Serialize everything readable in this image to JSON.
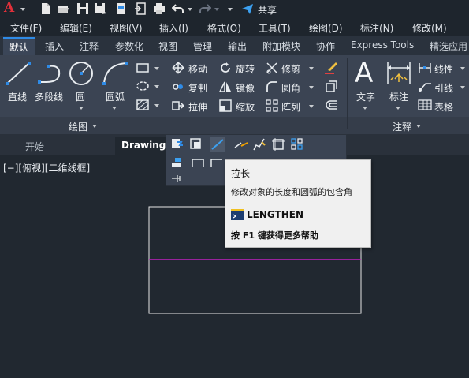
{
  "app": {
    "logo_letter": "A"
  },
  "qat": {
    "share_label": "共享"
  },
  "menubar": [
    "文件(F)",
    "编辑(E)",
    "视图(V)",
    "插入(I)",
    "格式(O)",
    "工具(T)",
    "绘图(D)",
    "标注(N)",
    "修改(M)"
  ],
  "ribbon_tabs": [
    {
      "label": "默认",
      "active": true
    },
    {
      "label": "插入"
    },
    {
      "label": "注释"
    },
    {
      "label": "参数化"
    },
    {
      "label": "视图"
    },
    {
      "label": "管理"
    },
    {
      "label": "输出"
    },
    {
      "label": "附加模块"
    },
    {
      "label": "协作"
    },
    {
      "label": "Express Tools"
    },
    {
      "label": "精选应用"
    }
  ],
  "draw_panel": {
    "title": "绘图",
    "line": "直线",
    "polyline": "多段线",
    "circle": "圆",
    "arc": "圆弧"
  },
  "modify_panel": {
    "move": "移动",
    "rotate": "旋转",
    "trim": "修剪",
    "copy": "复制",
    "mirror": "镜像",
    "fillet": "圆角",
    "stretch": "拉伸",
    "scale": "缩放",
    "array": "阵列"
  },
  "annotation_panel": {
    "title": "注释",
    "text": "文字",
    "dimension": "标注",
    "linear": "线性",
    "leader": "引线",
    "table": "表格"
  },
  "file_tabs": {
    "start": "开始",
    "drawing": "Drawing1"
  },
  "viewport": {
    "label": "[−][俯视][二维线框]"
  },
  "tooltip": {
    "title": "拉长",
    "description": "修改对象的长度和圆弧的包含角",
    "command": "LENGTHEN",
    "help": "按 F1 键获得更多帮助"
  },
  "colors": {
    "accent": "#2f8be6",
    "logo_red": "#e0303a",
    "magenta_line": "#c020c0",
    "background": "#212830"
  }
}
